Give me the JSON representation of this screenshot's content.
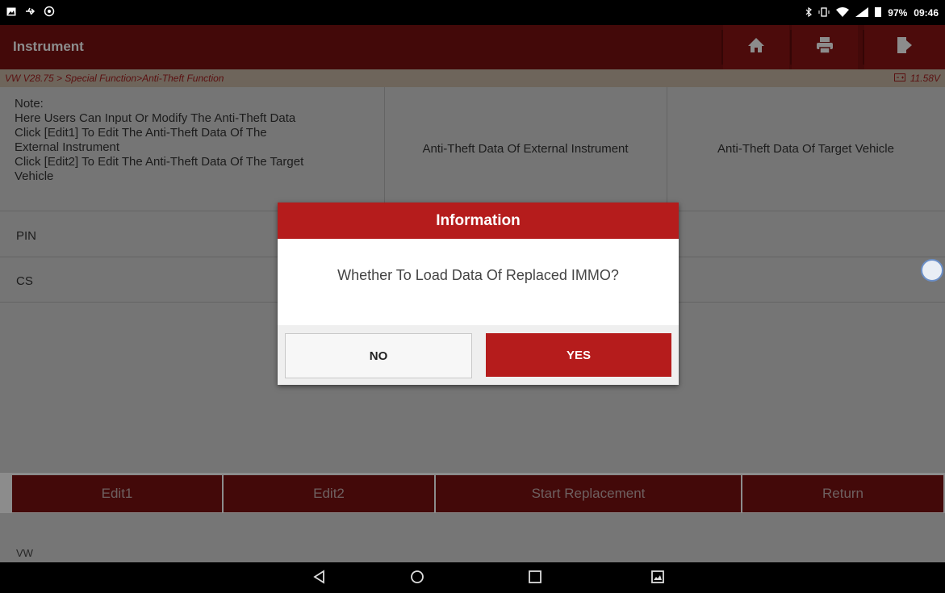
{
  "status_bar": {
    "battery": "97%",
    "time": "09:46",
    "icons": [
      "image-icon",
      "usb-icon",
      "settings-icon",
      "bluetooth-icon",
      "vibrate-icon",
      "wifi-icon",
      "signal-icon",
      "battery-icon"
    ]
  },
  "header": {
    "title": "Instrument",
    "buttons": [
      "home-icon",
      "print-icon",
      "exit-icon"
    ]
  },
  "breadcrumb": {
    "path": "VW V28.75 > Special Function>Anti-Theft Function",
    "voltage": "11.58V"
  },
  "table": {
    "note": [
      "Note:",
      "Here Users Can Input Or Modify The Anti-Theft Data",
      "Click [Edit1] To Edit The Anti-Theft Data Of The",
      "External Instrument",
      "Click [Edit2] To Edit The Anti-Theft Data Of The Target",
      "Vehicle"
    ],
    "columns": [
      "Anti-Theft Data Of External Instrument",
      "Anti-Theft Data Of Target Vehicle"
    ],
    "rows": [
      "PIN",
      "CS"
    ]
  },
  "dialog": {
    "title": "Information",
    "message": "Whether To Load Data Of Replaced IMMO?",
    "no_label": "NO",
    "yes_label": "YES"
  },
  "actions": [
    "Edit1",
    "Edit2",
    "Start Replacement",
    "Return"
  ],
  "footer": {
    "brand": "VW"
  },
  "colors": {
    "header": "#7a1212",
    "accent": "#b51c1c",
    "breadcrumb_bg": "#c9b8a7"
  }
}
